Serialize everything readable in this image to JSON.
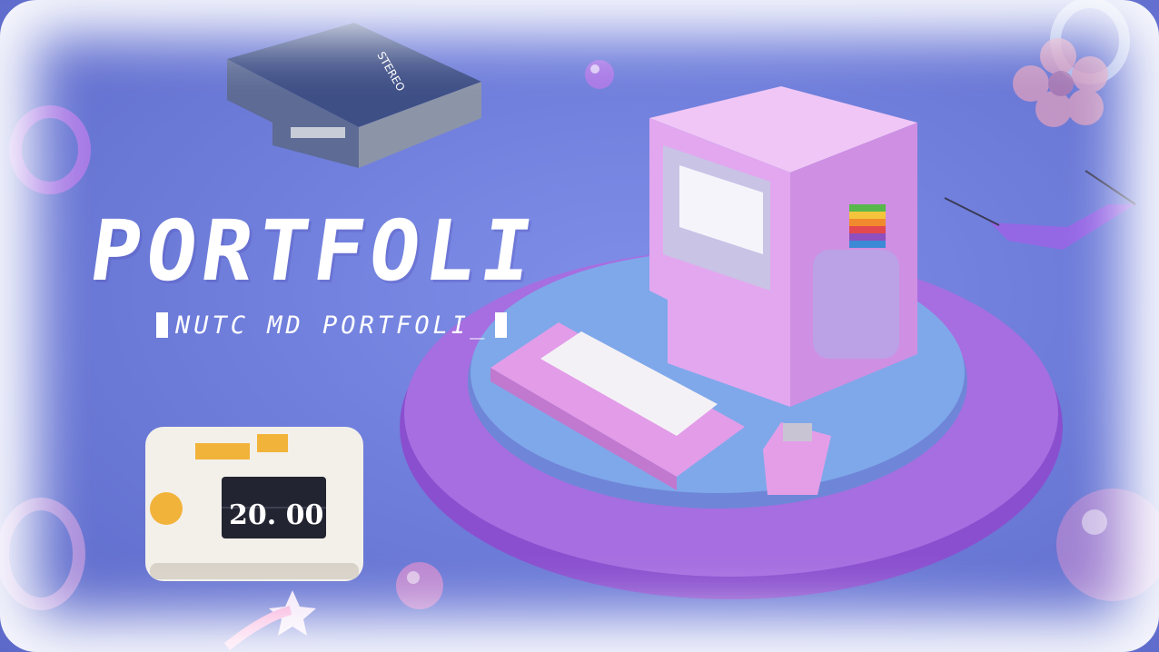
{
  "hero": {
    "title": "PORTFOLI",
    "subtitle": "NUTC MD PORTFOLI_"
  },
  "clock": {
    "time": "20. 00"
  },
  "walkman": {
    "label": "STEREO"
  },
  "colors": {
    "background": "#6f7edb",
    "platform_outer": "#a66ee0",
    "platform_inner": "#7fa8ea",
    "computer": "#e2a7ef",
    "clock_body": "#f3f0ea",
    "clock_accent": "#f2b33a",
    "walkman": "#4a5a8c"
  },
  "icons": [
    "apple-logo-sticker-icon",
    "star-sticker-icon"
  ]
}
